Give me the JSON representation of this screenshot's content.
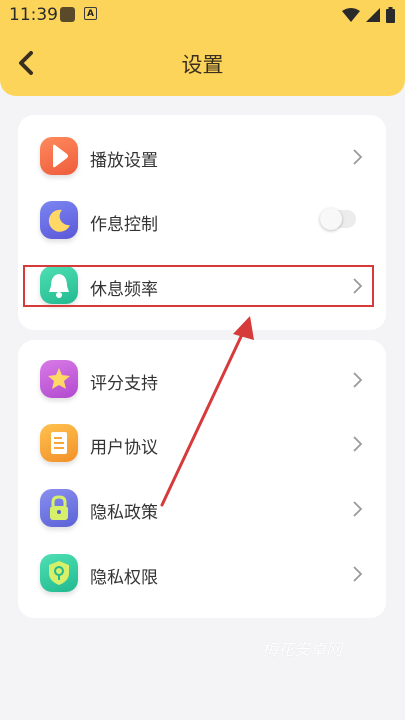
{
  "status_bar": {
    "time": "11:39",
    "notif_a": "A"
  },
  "header": {
    "title": "设置"
  },
  "group1": {
    "items": [
      {
        "label": "播放设置",
        "icon": "play-icon",
        "control": "chevron",
        "color": "#f0684a"
      },
      {
        "label": "作息控制",
        "icon": "moon-icon",
        "control": "toggle",
        "toggle_on": false,
        "color": "#6b6ee8"
      },
      {
        "label": "休息频率",
        "icon": "bell-icon",
        "control": "chevron",
        "highlighted": true,
        "color": "#35c9a0"
      }
    ]
  },
  "group2": {
    "items": [
      {
        "label": "评分支持",
        "icon": "star-icon",
        "control": "chevron",
        "color": "#c75ad6"
      },
      {
        "label": "用户协议",
        "icon": "document-icon",
        "control": "chevron",
        "color": "#f6a63a"
      },
      {
        "label": "隐私政策",
        "icon": "lock-icon",
        "control": "chevron",
        "color": "#6f7fe6"
      },
      {
        "label": "隐私权限",
        "icon": "location-shield-icon",
        "control": "chevron",
        "color": "#2fc2a0"
      }
    ]
  },
  "annotation": {
    "highlight_color": "#d63a3a"
  },
  "watermark": "梅花安卓网"
}
